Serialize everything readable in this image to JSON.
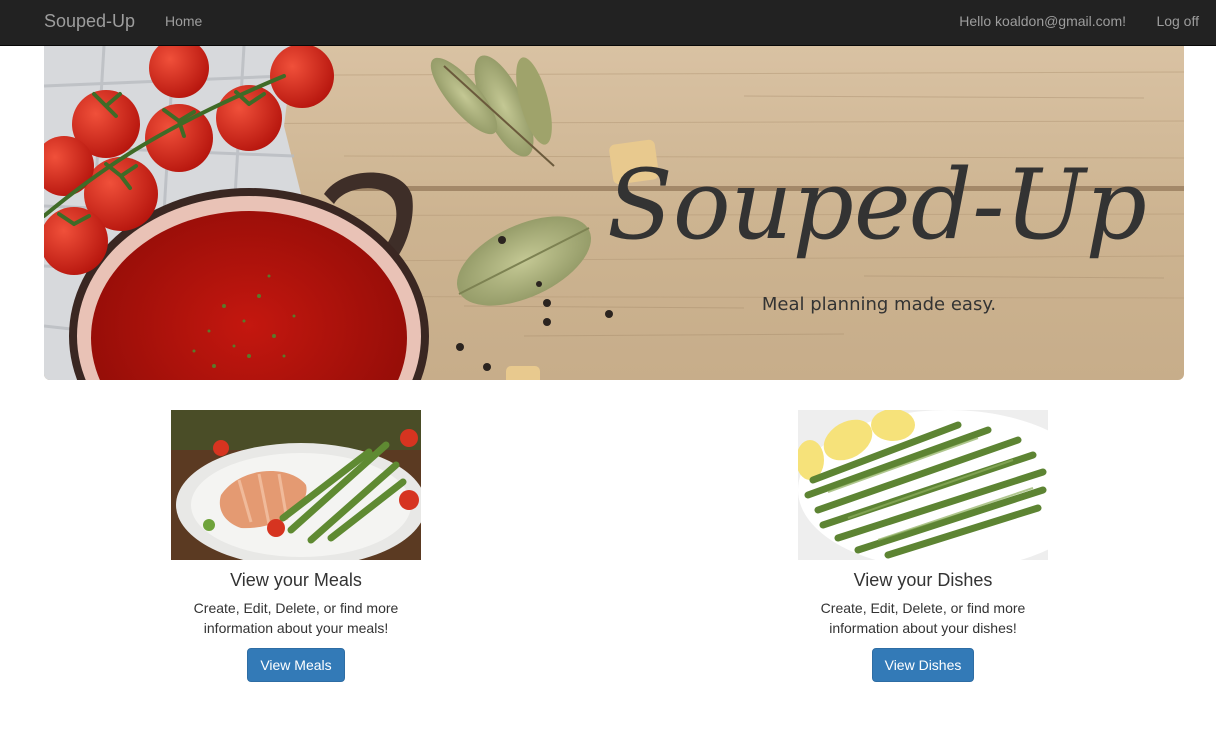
{
  "navbar": {
    "brand": "Souped-Up",
    "home": "Home",
    "greeting": "Hello koaldon@gmail.com!",
    "logoff": "Log off"
  },
  "hero": {
    "title": "Souped-Up",
    "tagline": "Meal planning made easy."
  },
  "cards": [
    {
      "title": "View your Meals",
      "description": "Create, Edit, Delete, or find more information about your meals!",
      "button": "View Meals"
    },
    {
      "title": "View your Dishes",
      "description": "Create, Edit, Delete, or find more information about your dishes!",
      "button": "View Dishes"
    }
  ],
  "colors": {
    "navbar_bg": "#222222",
    "navbar_text": "#9d9d9d",
    "button_primary": "#337ab7"
  }
}
